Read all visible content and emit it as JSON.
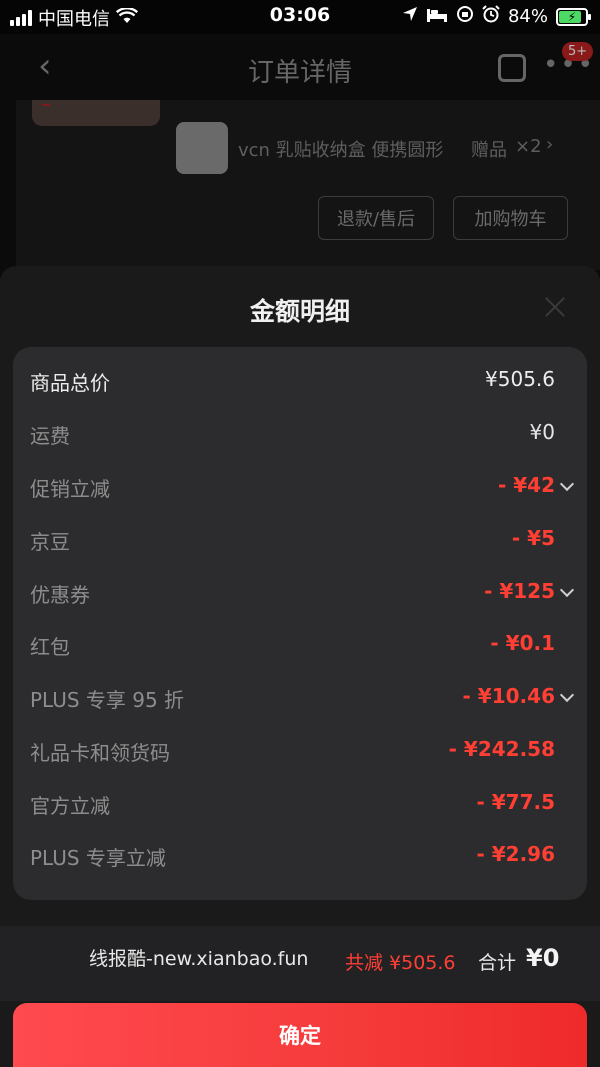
{
  "status_bar": {
    "carrier": "中国电信",
    "time": "03:06",
    "battery": "84%"
  },
  "nav": {
    "title": "订单详情",
    "badge": "5+"
  },
  "background": {
    "gift_name": "vcn 乳贴收纳盒 便携圆形",
    "gift_tag": "赠品",
    "gift_count": "×2",
    "refund_button": "退款/售后",
    "cart_button": "加购物车"
  },
  "sheet": {
    "title": "金额明细",
    "rows": [
      {
        "label": "商品总价",
        "value": "¥505.6"
      },
      {
        "label": "运费",
        "value": "¥0"
      },
      {
        "label": "促销立减",
        "value": "- ¥42"
      },
      {
        "label": "京豆",
        "value": "- ¥5"
      },
      {
        "label": "优惠券",
        "value": "- ¥125"
      },
      {
        "label": "红包",
        "value": "- ¥0.1"
      },
      {
        "label": "PLUS 专享 95 折",
        "value": "- ¥10.46"
      },
      {
        "label": "礼品卡和领货码",
        "value": "- ¥242.58"
      },
      {
        "label": "官方立减",
        "value": "- ¥77.5"
      },
      {
        "label": "PLUS 专享立减",
        "value": "- ¥2.96"
      }
    ]
  },
  "footer": {
    "watermark": "线报酷-new.xianbao.fun",
    "saving": "共减 ¥505.6",
    "total_label": "合计",
    "total_value": "¥0",
    "confirm_button": "确定"
  },
  "colors": {
    "accent_red": "#ff3f34",
    "button_gradient_start": "#ff4a4f",
    "button_gradient_end": "#ef2a2a",
    "card_bg": "#2c2c2e",
    "sheet_bg": "#1a1a1a"
  },
  "icons": [
    "signal-icon",
    "wifi-icon",
    "location-icon",
    "bed-icon",
    "lock-rotation-icon",
    "alarm-icon",
    "battery-icon",
    "back-icon",
    "share-icon",
    "more-icon",
    "close-icon",
    "chevron-down-icon"
  ]
}
